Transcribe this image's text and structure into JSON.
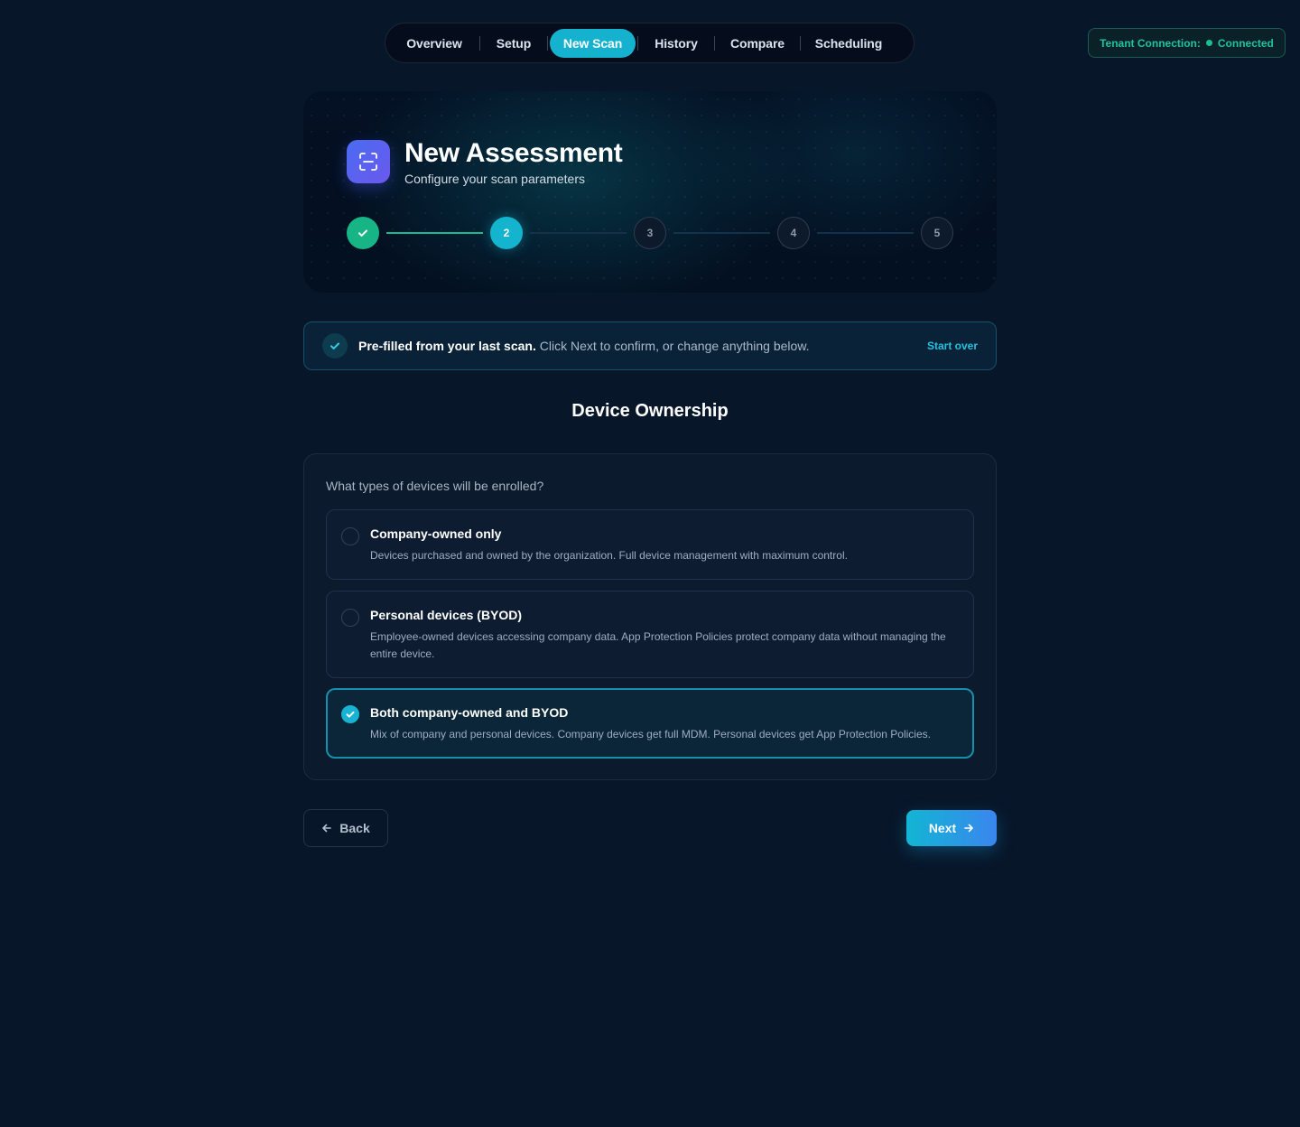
{
  "nav": {
    "items": [
      {
        "label": "Overview",
        "active": false
      },
      {
        "label": "Setup",
        "active": false
      },
      {
        "label": "New Scan",
        "active": true
      },
      {
        "label": "History",
        "active": false
      },
      {
        "label": "Compare",
        "active": false
      },
      {
        "label": "Scheduling",
        "active": false
      }
    ]
  },
  "tenant": {
    "label": "Tenant Connection:",
    "status": "Connected",
    "status_color": "#19c08f"
  },
  "hero": {
    "icon": "scan-icon",
    "title": "New Assessment",
    "subtitle": "Configure your scan parameters",
    "steps": [
      {
        "label": "",
        "state": "done"
      },
      {
        "label": "2",
        "state": "current"
      },
      {
        "label": "3",
        "state": "todo"
      },
      {
        "label": "4",
        "state": "todo"
      },
      {
        "label": "5",
        "state": "todo"
      }
    ]
  },
  "banner": {
    "bold": "Pre-filled from your last scan.",
    "text": " Click Next to confirm, or change anything below.",
    "action": "Start over"
  },
  "section": {
    "title": "Device Ownership",
    "question": "What types of devices will be enrolled?",
    "options": [
      {
        "title": "Company-owned only",
        "description": "Devices purchased and owned by the organization. Full device management with maximum control.",
        "selected": false
      },
      {
        "title": "Personal devices (BYOD)",
        "description": "Employee-owned devices accessing company data. App Protection Policies protect company data without managing the entire device.",
        "selected": false
      },
      {
        "title": "Both company-owned and BYOD",
        "description": "Mix of company and personal devices. Company devices get full MDM. Personal devices get App Protection Policies.",
        "selected": true
      }
    ]
  },
  "footer": {
    "back_label": "Back",
    "next_label": "Next"
  },
  "colors": {
    "background": "#081629",
    "accent": "#14b2cf",
    "success": "#17b585"
  }
}
